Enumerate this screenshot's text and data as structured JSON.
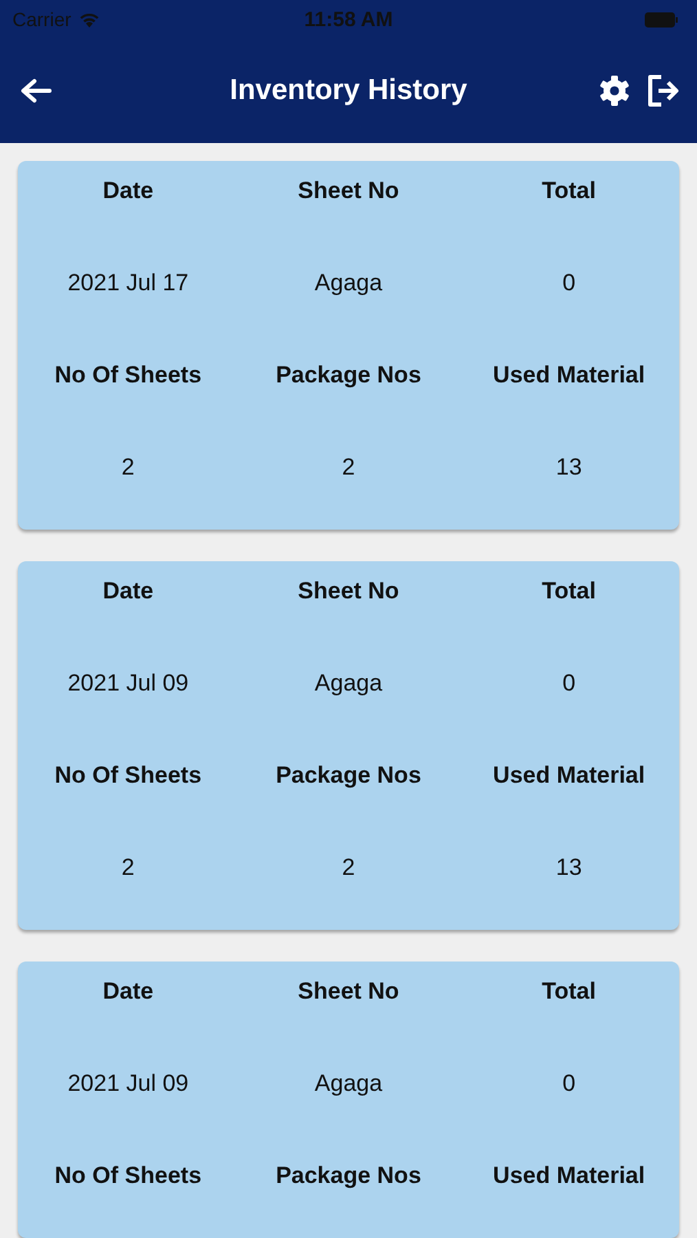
{
  "status_bar": {
    "carrier": "Carrier",
    "time": "11:58 AM"
  },
  "nav_bar": {
    "title": "Inventory History"
  },
  "cards": [
    {
      "rows": [
        {
          "kind": "header",
          "cells": [
            "Date",
            "Sheet No",
            "Total"
          ]
        },
        {
          "kind": "value",
          "cells": [
            "2021 Jul 17",
            "Agaga",
            "0"
          ]
        },
        {
          "kind": "header",
          "cells": [
            "No Of Sheets",
            "Package Nos",
            "Used Material"
          ]
        },
        {
          "kind": "value",
          "cells": [
            "2",
            "2",
            "13"
          ]
        }
      ]
    },
    {
      "rows": [
        {
          "kind": "header",
          "cells": [
            "Date",
            "Sheet No",
            "Total"
          ]
        },
        {
          "kind": "value",
          "cells": [
            "2021 Jul 09",
            "Agaga",
            "0"
          ]
        },
        {
          "kind": "header",
          "cells": [
            "No Of Sheets",
            "Package Nos",
            "Used Material"
          ]
        },
        {
          "kind": "value",
          "cells": [
            "2",
            "2",
            "13"
          ]
        }
      ]
    },
    {
      "rows": [
        {
          "kind": "header",
          "cells": [
            "Date",
            "Sheet No",
            "Total"
          ]
        },
        {
          "kind": "value",
          "cells": [
            "2021 Jul 09",
            "Agaga",
            "0"
          ]
        },
        {
          "kind": "header",
          "cells": [
            "No Of Sheets",
            "Package Nos",
            "Used Material"
          ]
        }
      ]
    }
  ]
}
